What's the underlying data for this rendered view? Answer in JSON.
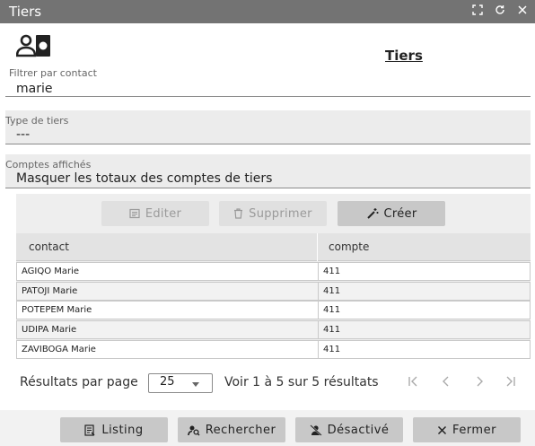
{
  "window": {
    "title": "Tiers"
  },
  "icons": {
    "fullscreen": "fullscreen-icon",
    "refresh": "refresh-icon",
    "close": "close-icon",
    "header": "contact-card-icon"
  },
  "page": {
    "title": "Tiers"
  },
  "filters": {
    "contact": {
      "label": "Filtrer par contact",
      "value": "marie"
    },
    "type": {
      "label": "Type de tiers",
      "value": "---"
    },
    "comptes": {
      "label": "Comptes affichés",
      "value": "Masquer les totaux des comptes de tiers"
    }
  },
  "toolbar": {
    "edit_label": "Editer",
    "delete_label": "Supprimer",
    "create_label": "Créer"
  },
  "table": {
    "columns": [
      "contact",
      "compte"
    ],
    "rows": [
      {
        "contact": "AGIQO Marie",
        "compte": "411"
      },
      {
        "contact": "PATOJI Marie",
        "compte": "411"
      },
      {
        "contact": "POTEPEM Marie",
        "compte": "411"
      },
      {
        "contact": "UDIPA Marie",
        "compte": "411"
      },
      {
        "contact": "ZAVIBOGA Marie",
        "compte": "411"
      }
    ]
  },
  "pagination": {
    "per_page_label": "Résultats par page",
    "per_page_value": "25",
    "info": "Voir 1 à 5 sur 5 résultats"
  },
  "footer": {
    "listing_label": "Listing",
    "search_label": "Rechercher",
    "deactivate_label": "Désactivé",
    "close_label": "Fermer"
  },
  "colors": {
    "titlebar": "#737373",
    "button": "#c8c8c8",
    "button_disabled": "#e0e0e0",
    "panel": "#eeeeee"
  }
}
